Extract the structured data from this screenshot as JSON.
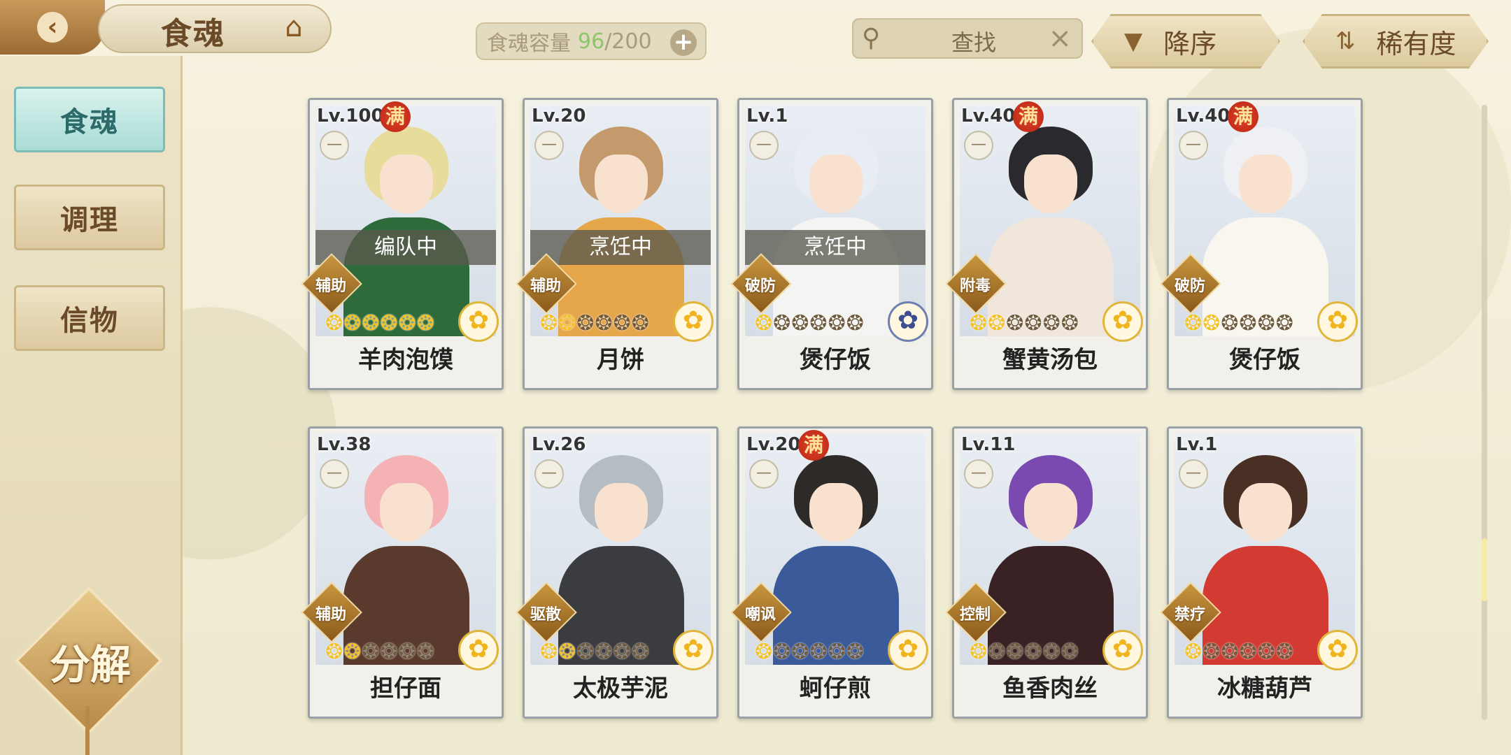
{
  "header": {
    "title": "食魂",
    "capacity_label": "食魂容量",
    "capacity_used": "96",
    "capacity_total": "/200",
    "search_label": "查找",
    "sort_label": "降序",
    "rarity_label": "稀有度"
  },
  "sidebar": {
    "items": [
      {
        "label": "食魂",
        "active": true
      },
      {
        "label": "调理",
        "active": false
      },
      {
        "label": "信物",
        "active": false
      }
    ],
    "decompose_label": "分解"
  },
  "colors": {
    "accent_teal": "#a9dcd5",
    "gold": "#c8963e",
    "capacity_green": "#8ec46c",
    "full_badge_red": "#d23a22"
  },
  "cards": [
    {
      "level": "Lv.100",
      "full": "满",
      "status": "编队中",
      "role": "辅助",
      "stars": 6,
      "stars_max": 6,
      "name": "羊肉泡馍",
      "flower": "gold",
      "hair": "#e8dc9c",
      "outfit": "#2f6b3a"
    },
    {
      "level": "Lv.20",
      "full": "",
      "status": "烹饪中",
      "role": "辅助",
      "stars": 2,
      "stars_max": 6,
      "name": "月饼",
      "flower": "gold",
      "hair": "#c49a6c",
      "outfit": "#e6a64a"
    },
    {
      "level": "Lv.1",
      "full": "",
      "status": "烹饪中",
      "role": "破防",
      "stars": 1,
      "stars_max": 6,
      "name": "煲仔饭",
      "flower": "blue",
      "hair": "#e8ecf4",
      "outfit": "#f4f4f2"
    },
    {
      "level": "Lv.40",
      "full": "满",
      "status": "",
      "role": "附毒",
      "stars": 2,
      "stars_max": 6,
      "name": "蟹黄汤包",
      "flower": "gold",
      "hair": "#2a2a2e",
      "outfit": "#f0e6dc"
    },
    {
      "level": "Lv.40",
      "full": "满",
      "status": "",
      "role": "破防",
      "stars": 2,
      "stars_max": 6,
      "name": "煲仔饭",
      "flower": "gold",
      "hair": "#eef0f4",
      "outfit": "#f8f6ee"
    },
    {
      "level": "Lv.38",
      "full": "",
      "status": "",
      "role": "辅助",
      "stars": 2,
      "stars_max": 6,
      "name": "担仔面",
      "flower": "gold",
      "hair": "#f4b2b4",
      "outfit": "#5a3a2c"
    },
    {
      "level": "Lv.26",
      "full": "",
      "status": "",
      "role": "驱散",
      "stars": 2,
      "stars_max": 6,
      "name": "太极芋泥",
      "flower": "gold",
      "hair": "#b4bcc4",
      "outfit": "#3a3c40"
    },
    {
      "level": "Lv.20",
      "full": "满",
      "status": "",
      "role": "嘲讽",
      "stars": 1,
      "stars_max": 6,
      "name": "蚵仔煎",
      "flower": "gold",
      "hair": "#2e2a28",
      "outfit": "#3a5a9a"
    },
    {
      "level": "Lv.11",
      "full": "",
      "status": "",
      "role": "控制",
      "stars": 1,
      "stars_max": 6,
      "name": "鱼香肉丝",
      "flower": "gold",
      "hair": "#7a4ab0",
      "outfit": "#3a2224"
    },
    {
      "level": "Lv.1",
      "full": "",
      "status": "",
      "role": "禁疗",
      "stars": 1,
      "stars_max": 6,
      "name": "冰糖葫芦",
      "flower": "gold",
      "hair": "#4a3024",
      "outfit": "#d23a32"
    }
  ]
}
